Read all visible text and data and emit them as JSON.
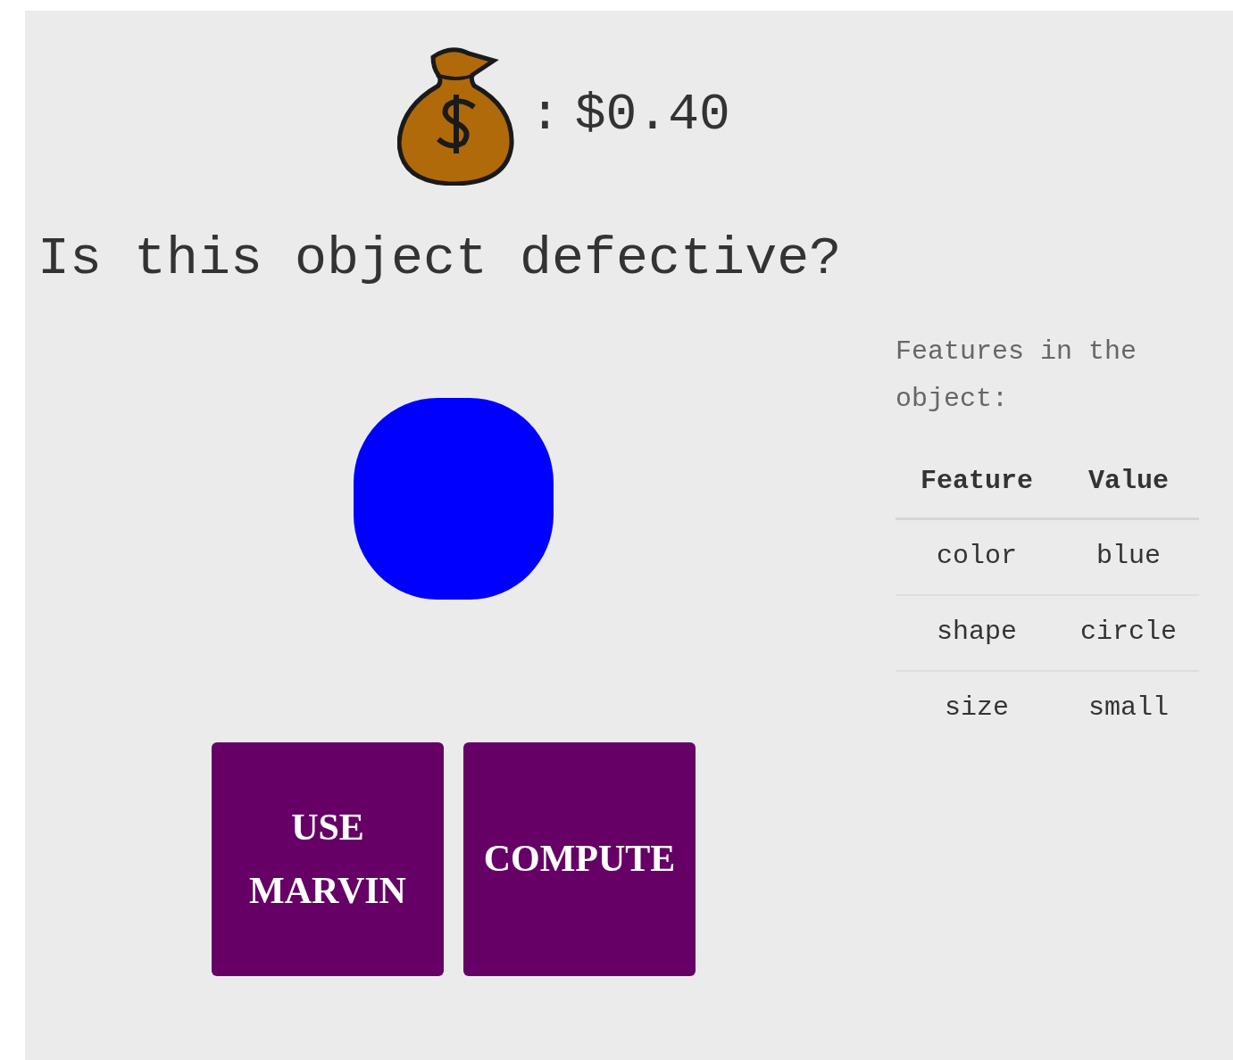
{
  "balance": {
    "separator": ":",
    "amount": "$0.40"
  },
  "question": "Is this object defective?",
  "features": {
    "caption": "Features in the object:",
    "columns": [
      "Feature",
      "Value"
    ],
    "rows": [
      [
        "color",
        "blue"
      ],
      [
        "shape",
        "circle"
      ],
      [
        "size",
        "small"
      ]
    ]
  },
  "buttons": [
    "USE MARVIN",
    "COMPUTE"
  ]
}
